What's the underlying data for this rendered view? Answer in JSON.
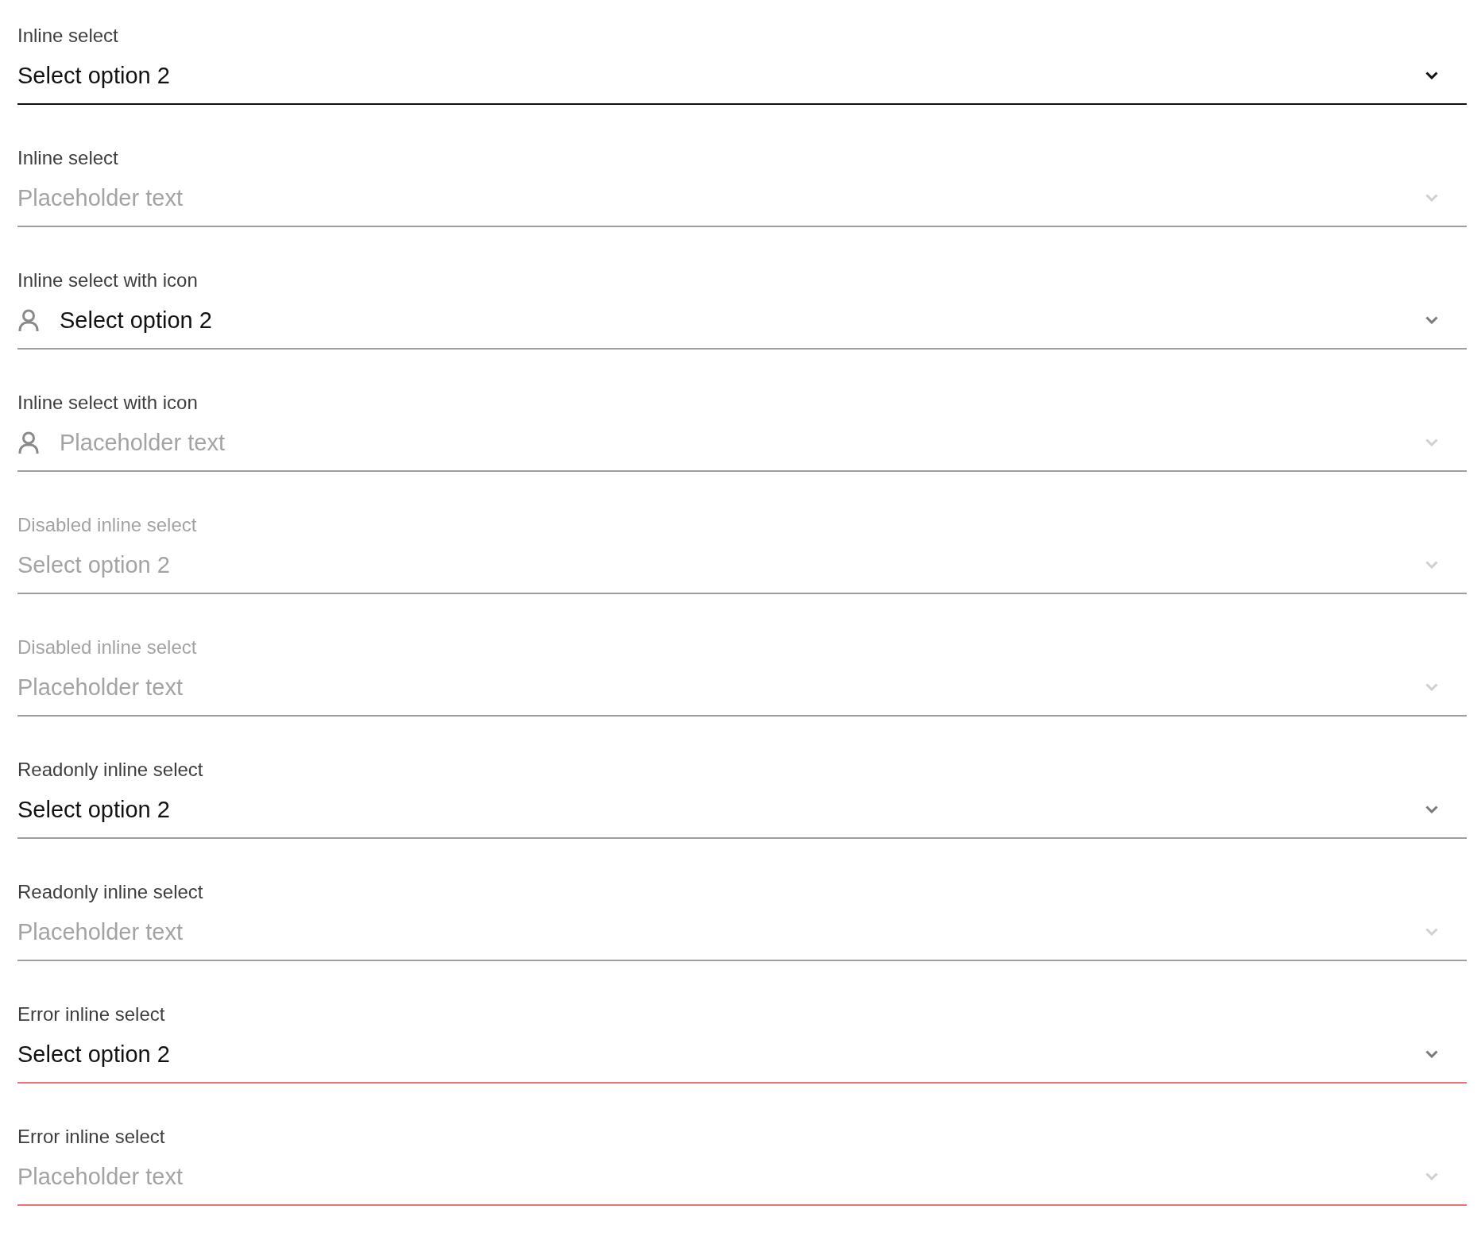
{
  "selects": [
    {
      "label": "Inline select",
      "kind": "plain",
      "value": "Select option 2",
      "disabled": false,
      "error": false,
      "focused": true
    },
    {
      "label": "Inline select",
      "kind": "plain",
      "placeholder": "Placeholder text",
      "disabled": false,
      "error": false,
      "focused": false
    },
    {
      "label": "Inline select with icon",
      "kind": "icon",
      "value": "Select option 2",
      "disabled": false,
      "error": false,
      "focused": false
    },
    {
      "label": "Inline select with icon",
      "kind": "icon",
      "placeholder": "Placeholder text",
      "disabled": false,
      "error": false,
      "focused": false
    },
    {
      "label": "Disabled inline select",
      "kind": "plain",
      "value": "Select option 2",
      "disabled": true,
      "error": false,
      "focused": false
    },
    {
      "label": "Disabled inline select",
      "kind": "plain",
      "placeholder": "Placeholder text",
      "disabled": true,
      "error": false,
      "focused": false
    },
    {
      "label": "Readonly inline select",
      "kind": "plain",
      "value": "Select option 2",
      "disabled": false,
      "error": false,
      "focused": false
    },
    {
      "label": "Readonly inline select",
      "kind": "plain",
      "placeholder": "Placeholder text",
      "disabled": false,
      "error": false,
      "focused": false
    },
    {
      "label": "Error inline select",
      "kind": "plain",
      "value": "Select option 2",
      "disabled": false,
      "error": true,
      "focused": false
    },
    {
      "label": "Error inline select",
      "kind": "plain",
      "placeholder": "Placeholder text",
      "disabled": false,
      "error": true,
      "focused": false
    }
  ]
}
